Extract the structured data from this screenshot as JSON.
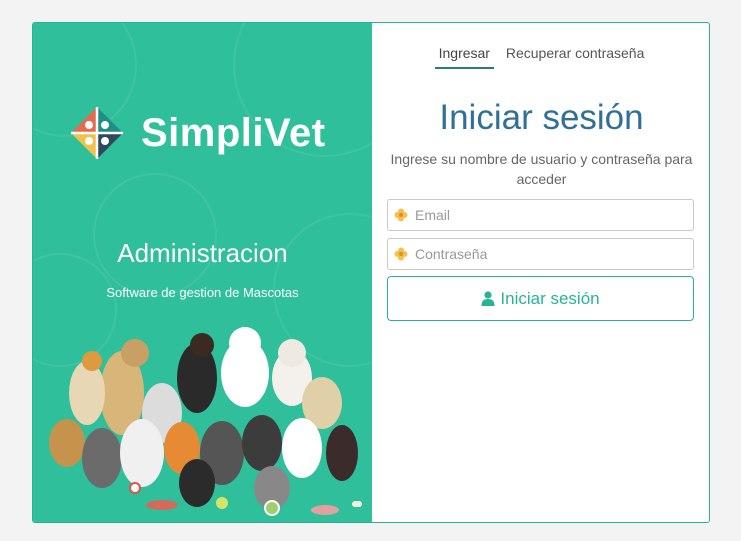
{
  "brand": {
    "name": "SimpliVet",
    "title": "Administracion",
    "subtitle": "Software de gestion de Mascotas"
  },
  "tabs": [
    {
      "label": "Ingresar",
      "active": true
    },
    {
      "label": "Recuperar contraseña",
      "active": false
    }
  ],
  "login": {
    "title": "Iniciar sesión",
    "description": "Ingrese su nombre de usuario y contraseña para acceder",
    "email_placeholder": "Email",
    "password_placeholder": "Contraseña",
    "submit_label": "Iniciar sesión"
  },
  "colors": {
    "accent": "#27b495",
    "panel": "#2fbf9a",
    "title": "#2f7096"
  },
  "icons": {
    "field_icon": "flower-icon",
    "button_icon": "user-icon"
  }
}
